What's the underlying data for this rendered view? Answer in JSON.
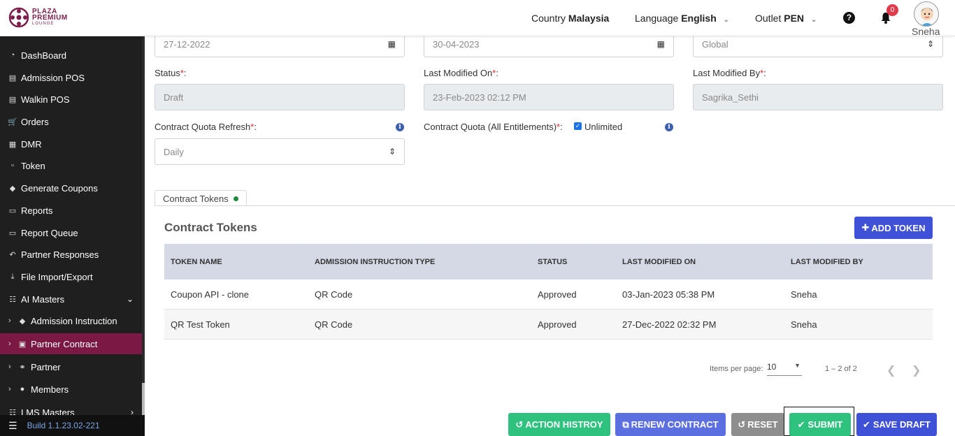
{
  "header": {
    "brand_line1": "PLAZA",
    "brand_line2": "PREMIUM",
    "brand_line3": "LOUNGE",
    "country_label": "Country",
    "country_value": "Malaysia",
    "language_label": "Language",
    "language_value": "English",
    "outlet_label": "Outlet",
    "outlet_value": "PEN",
    "notification_count": "0",
    "user_name": "Sneha"
  },
  "sidebar": {
    "items": [
      {
        "label": "DashBoard",
        "icon": "dashboard-icon"
      },
      {
        "label": "Admission POS",
        "icon": "id-card-icon"
      },
      {
        "label": "Walkin POS",
        "icon": "id-card-icon"
      },
      {
        "label": "Orders",
        "icon": "cart-icon"
      },
      {
        "label": "DMR",
        "icon": "calendar-icon"
      },
      {
        "label": "Token",
        "icon": "document-icon"
      },
      {
        "label": "Generate Coupons",
        "icon": "ticket-icon"
      },
      {
        "label": "Reports",
        "icon": "book-icon"
      },
      {
        "label": "Report Queue",
        "icon": "book-icon"
      },
      {
        "label": "Partner Responses",
        "icon": "reply-icon"
      },
      {
        "label": "File Import/Export",
        "icon": "download-icon"
      },
      {
        "label": "AI Masters",
        "icon": "sitemap-icon"
      },
      {
        "label": "Admission Instruction",
        "icon": "ticket-icon"
      },
      {
        "label": "Partner Contract",
        "icon": "briefcase-icon"
      },
      {
        "label": "Partner",
        "icon": "handshake-icon"
      },
      {
        "label": "Members",
        "icon": "users-icon"
      },
      {
        "label": "LMS Masters",
        "icon": "sitemap-icon"
      }
    ],
    "build": "Build 1.1.23.02-221"
  },
  "form": {
    "start_date": "27-12-2022",
    "end_date": "30-04-2023",
    "region_value": "Global",
    "status_label": "Status",
    "status_value": "Draft",
    "last_modified_on_label": "Last Modified On",
    "last_modified_on_value": "23-Feb-2023 02:12 PM",
    "last_modified_by_label": "Last Modified By",
    "last_modified_by_value": "Sagrika_Sethi",
    "quota_refresh_label": "Contract Quota Refresh",
    "quota_refresh_value": "Daily",
    "quota_label": "Contract Quota (All Entitlements)",
    "unlimited_label": "Unlimited",
    "required_mark": "*",
    "colon": ":"
  },
  "tokens": {
    "tab_label": "Contract Tokens",
    "section_title": "Contract Tokens",
    "add_button": "ADD TOKEN",
    "columns": [
      "TOKEN NAME",
      "ADMISSION INSTRUCTION TYPE",
      "STATUS",
      "LAST MODIFIED ON",
      "LAST MODIFIED BY"
    ],
    "rows": [
      [
        "Coupon API - clone",
        "QR Code",
        "Approved",
        "03-Jan-2023 05:38 PM",
        "Sneha"
      ],
      [
        "QR Test Token",
        "QR Code",
        "Approved",
        "27-Dec-2022 02:32 PM",
        "Sneha"
      ]
    ],
    "items_per_page_label": "Items per page:",
    "items_per_page_value": "10",
    "range_label": "1 – 2 of 2"
  },
  "actions": {
    "action_history": "ACTION HISTROY",
    "renew_contract": "RENEW CONTRACT",
    "reset": "RESET",
    "submit": "SUBMIT",
    "save_draft": "SAVE DRAFT"
  },
  "colors": {
    "brand": "#7b1843",
    "primary": "#3f51d7",
    "success": "#2ec27e",
    "sidebar_bg": "#1f1f1f"
  }
}
